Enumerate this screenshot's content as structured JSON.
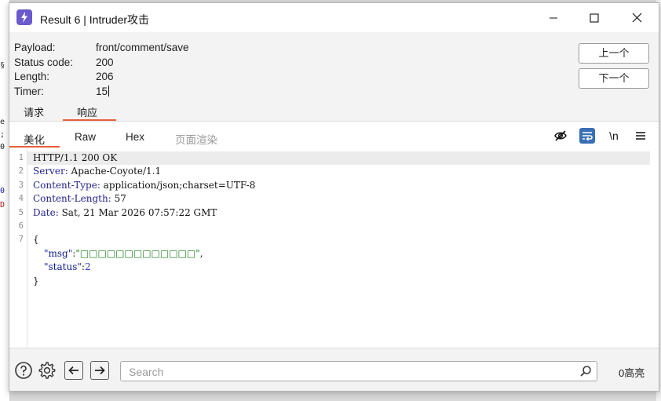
{
  "window": {
    "title": "Result 6 | Intruder攻击",
    "controls": [
      "minimize-icon",
      "maximize-icon",
      "close-icon"
    ]
  },
  "info": {
    "payload_label": "Payload:",
    "payload_value": "front/comment/save",
    "status_label": "Status code:",
    "status_value": "200",
    "length_label": "Length:",
    "length_value": "206",
    "timer_label": "Timer:",
    "timer_value": "15"
  },
  "nav": {
    "prev_label": "上一个",
    "next_label": "下一个"
  },
  "main_tabs": [
    {
      "label": "请求",
      "active": false
    },
    {
      "label": "响应",
      "active": true
    }
  ],
  "view_tabs": [
    {
      "label": "美化",
      "active": true
    },
    {
      "label": "Raw",
      "active": false
    },
    {
      "label": "Hex",
      "active": false
    },
    {
      "label": "页面渲染",
      "active": false
    }
  ],
  "toolbar_icons": [
    "eye-off-icon",
    "wrap-lines-icon",
    "newline-toggle-icon",
    "menu-icon"
  ],
  "toolbar_newline_label": "\\n",
  "editor": {
    "line_numbers": [
      "1",
      "2",
      "3",
      "4",
      "5",
      "6",
      "7"
    ],
    "status_line": "HTTP/1.1 200 OK",
    "headers": [
      {
        "name": "Server",
        "value": "Apache-Coyote/1.1"
      },
      {
        "name": "Content-Type",
        "value": "application/json;charset=UTF-8"
      },
      {
        "name": "Content-Length",
        "value": "57"
      },
      {
        "name": "Date",
        "value": "Sat, 21 Mar 2026 07:57:22 GMT"
      }
    ],
    "body_open": "{",
    "msg_key": "\"msg\"",
    "msg_value": "\"□□□□□□□□□□□□□\"",
    "status_key": "\"status\"",
    "status_value": "2",
    "body_close": "}",
    "colon": ":",
    "comma": ","
  },
  "bottom": {
    "search_placeholder": "Search",
    "hits": "0高亮",
    "icons": [
      "help-icon",
      "settings-icon",
      "back-arrow-icon",
      "forward-arrow-icon",
      "search-icon"
    ]
  },
  "colors": {
    "accent_underline": "#e8603c",
    "active_icon_bg": "#3a6fb5",
    "app_icon": "#6a5acd"
  }
}
